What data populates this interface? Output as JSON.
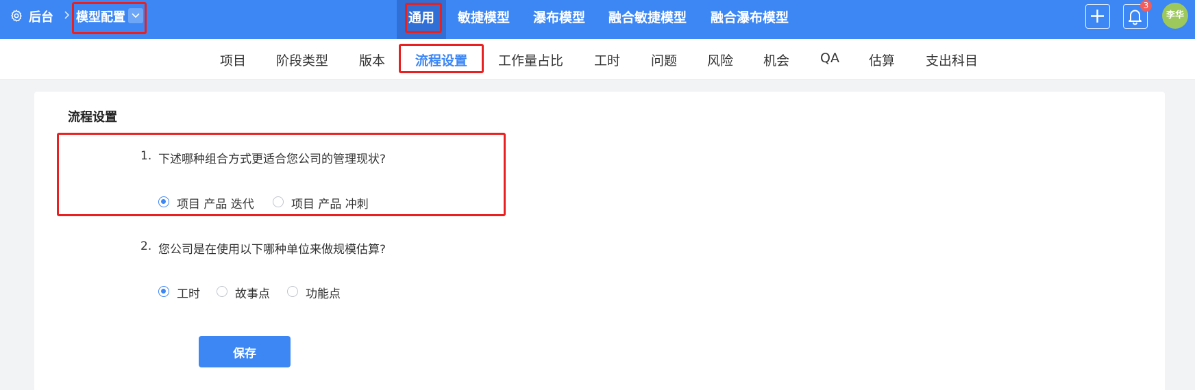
{
  "topbar": {
    "backstage_label": "后台",
    "model_config_label": "模型配置",
    "tabs": [
      "通用",
      "敏捷模型",
      "瀑布模型",
      "融合敏捷模型",
      "融合瀑布模型"
    ],
    "active_tab": "通用",
    "notification_count": "3",
    "user_name": "李华",
    "colors": {
      "bar": "#3d87f5",
      "active_tab_bg": "#2f6fd6",
      "avatar": "#9cc85c",
      "badge": "#f15c5c"
    }
  },
  "subnav": {
    "tabs": [
      "项目",
      "阶段类型",
      "版本",
      "流程设置",
      "工作量占比",
      "工时",
      "问题",
      "风险",
      "机会",
      "QA",
      "估算",
      "支出科目"
    ],
    "active_tab": "流程设置"
  },
  "content": {
    "title": "流程设置",
    "questions": [
      {
        "number": "1.",
        "text": "下述哪种组合方式更适合您公司的管理现状?",
        "options": [
          "项目 产品 迭代",
          "项目 产品 冲刺"
        ],
        "selected": "项目 产品 迭代"
      },
      {
        "number": "2.",
        "text": "您公司是在使用以下哪种单位来做规模估算?",
        "options": [
          "工时",
          "故事点",
          "功能点"
        ],
        "selected": "工时"
      }
    ],
    "save_label": "保存"
  },
  "icons": [
    "gear-icon",
    "chevron-right-icon",
    "chevron-down-icon",
    "plus-icon",
    "bell-icon"
  ]
}
